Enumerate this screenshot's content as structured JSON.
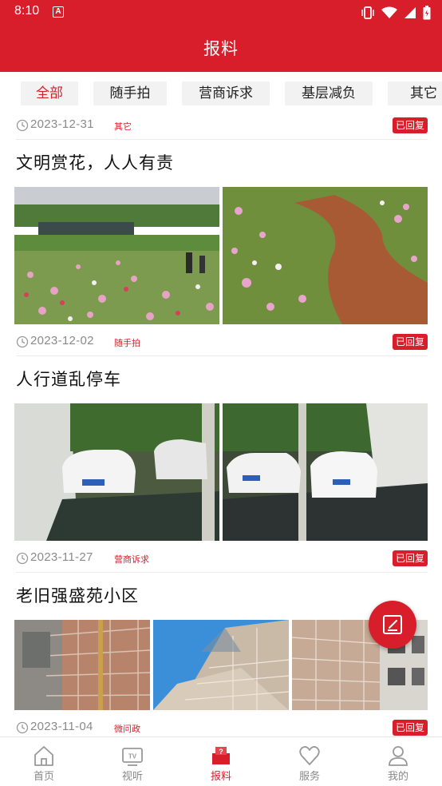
{
  "status_bar": {
    "time": "8:10",
    "a_icon": "A"
  },
  "header": {
    "title": "报料"
  },
  "tabs": [
    {
      "label": "全部",
      "active": true
    },
    {
      "label": "随手拍",
      "active": false
    },
    {
      "label": "营商诉求",
      "active": false
    },
    {
      "label": "基层减负",
      "active": false
    },
    {
      "label": "其它",
      "active": false
    }
  ],
  "posts": [
    {
      "date": "2023-12-31",
      "category": "其它",
      "status": "已回复"
    },
    {
      "title": "文明赏花，人人有责",
      "date": "2023-12-02",
      "category": "随手拍",
      "status": "已回复"
    },
    {
      "title": "人行道乱停车",
      "date": "2023-11-27",
      "category": "营商诉求",
      "status": "已回复"
    },
    {
      "title": "老旧强盛苑小区",
      "date": "2023-11-04",
      "category": "微问政",
      "status": "已回复"
    }
  ],
  "bottom_nav": [
    {
      "label": "首页",
      "icon": "home-icon",
      "active": false
    },
    {
      "label": "视听",
      "icon": "tv-icon",
      "active": false
    },
    {
      "label": "报料",
      "icon": "report-icon",
      "active": true
    },
    {
      "label": "服务",
      "icon": "heart-icon",
      "active": false
    },
    {
      "label": "我的",
      "icon": "user-icon",
      "active": false
    }
  ],
  "colors": {
    "brand_red": "#d81e2b",
    "muted_text": "#8a8a8a"
  }
}
